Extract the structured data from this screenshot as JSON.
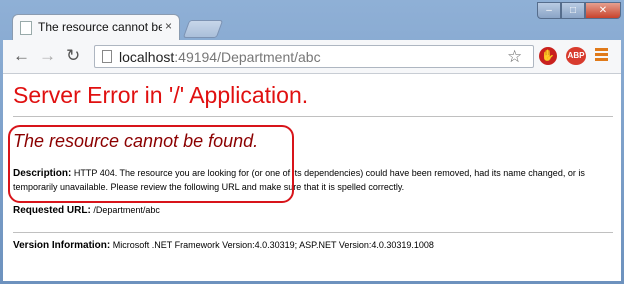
{
  "browser": {
    "tab_title": "The resource cannot be fo",
    "tab_close": "×",
    "url_host": "localhost",
    "url_rest": ":49194/Department/abc",
    "ext_abp_label": "ABP",
    "window_buttons": {
      "minimize": "–",
      "maximize": "□",
      "close": "✕"
    },
    "nav": {
      "back": "←",
      "forward": "→",
      "reload": "↻",
      "star": "☆"
    }
  },
  "page": {
    "heading": "Server Error in '/' Application.",
    "subheading": "The resource cannot be found.",
    "description_label": "Description:",
    "description_text": "HTTP 404. The resource you are looking for (or one of its dependencies) could have been removed, had its name changed, or is temporarily unavailable.  Please review the following URL and make sure that it is spelled correctly.",
    "requested_url_label": "Requested URL:",
    "requested_url_value": "/Department/abc",
    "version_label": "Version Information:",
    "version_value": "Microsoft .NET Framework Version:4.0.30319; ASP.NET Version:4.0.30319.1008"
  },
  "colors": {
    "heading": "#e01010",
    "subheading": "#8b0000",
    "annotation": "#d8141a"
  }
}
